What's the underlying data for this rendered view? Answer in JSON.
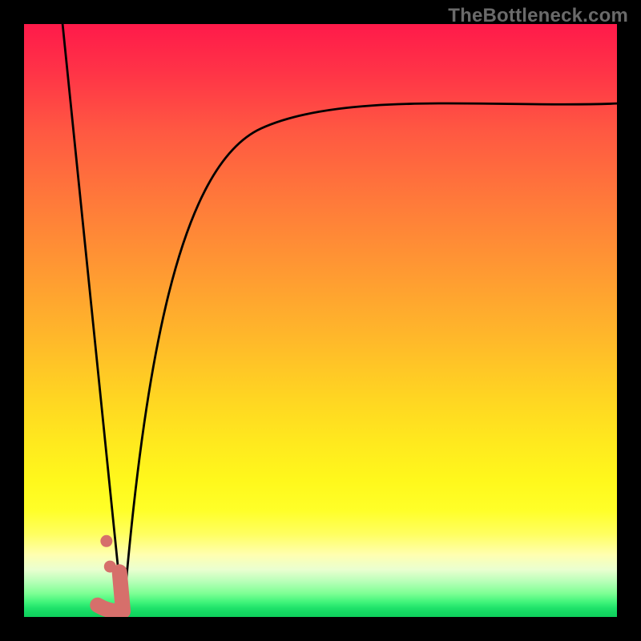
{
  "watermark": "TheBottleneck.com",
  "chart_data": {
    "type": "line",
    "title": "",
    "xlabel": "",
    "ylabel": "",
    "optimum_x_fraction": 0.167,
    "curves": {
      "left": {
        "x_start_fraction": 0.065,
        "x_end_fraction": 0.167
      },
      "right": {
        "x_end_fraction": 1.0,
        "y_end_fraction": 0.866
      }
    },
    "data_points": [
      {
        "x_fraction": 0.139,
        "y_fraction": 0.128
      },
      {
        "x_fraction": 0.145,
        "y_fraction": 0.085
      }
    ],
    "optimum_marker": {
      "top": {
        "x_fraction": 0.161,
        "y_fraction": 0.076
      },
      "corner": {
        "x_fraction": 0.167,
        "y_fraction": 0.01
      },
      "left": {
        "x_fraction": 0.124,
        "y_fraction": 0.02
      }
    },
    "gradient_note": "Color scale from red (high bottleneck) at top to green (low bottleneck) at bottom; numeric axis values not shown in image."
  },
  "colors": {
    "curve": "#000000",
    "marker": "#d66f6b",
    "watermark": "#6a6a6a"
  }
}
